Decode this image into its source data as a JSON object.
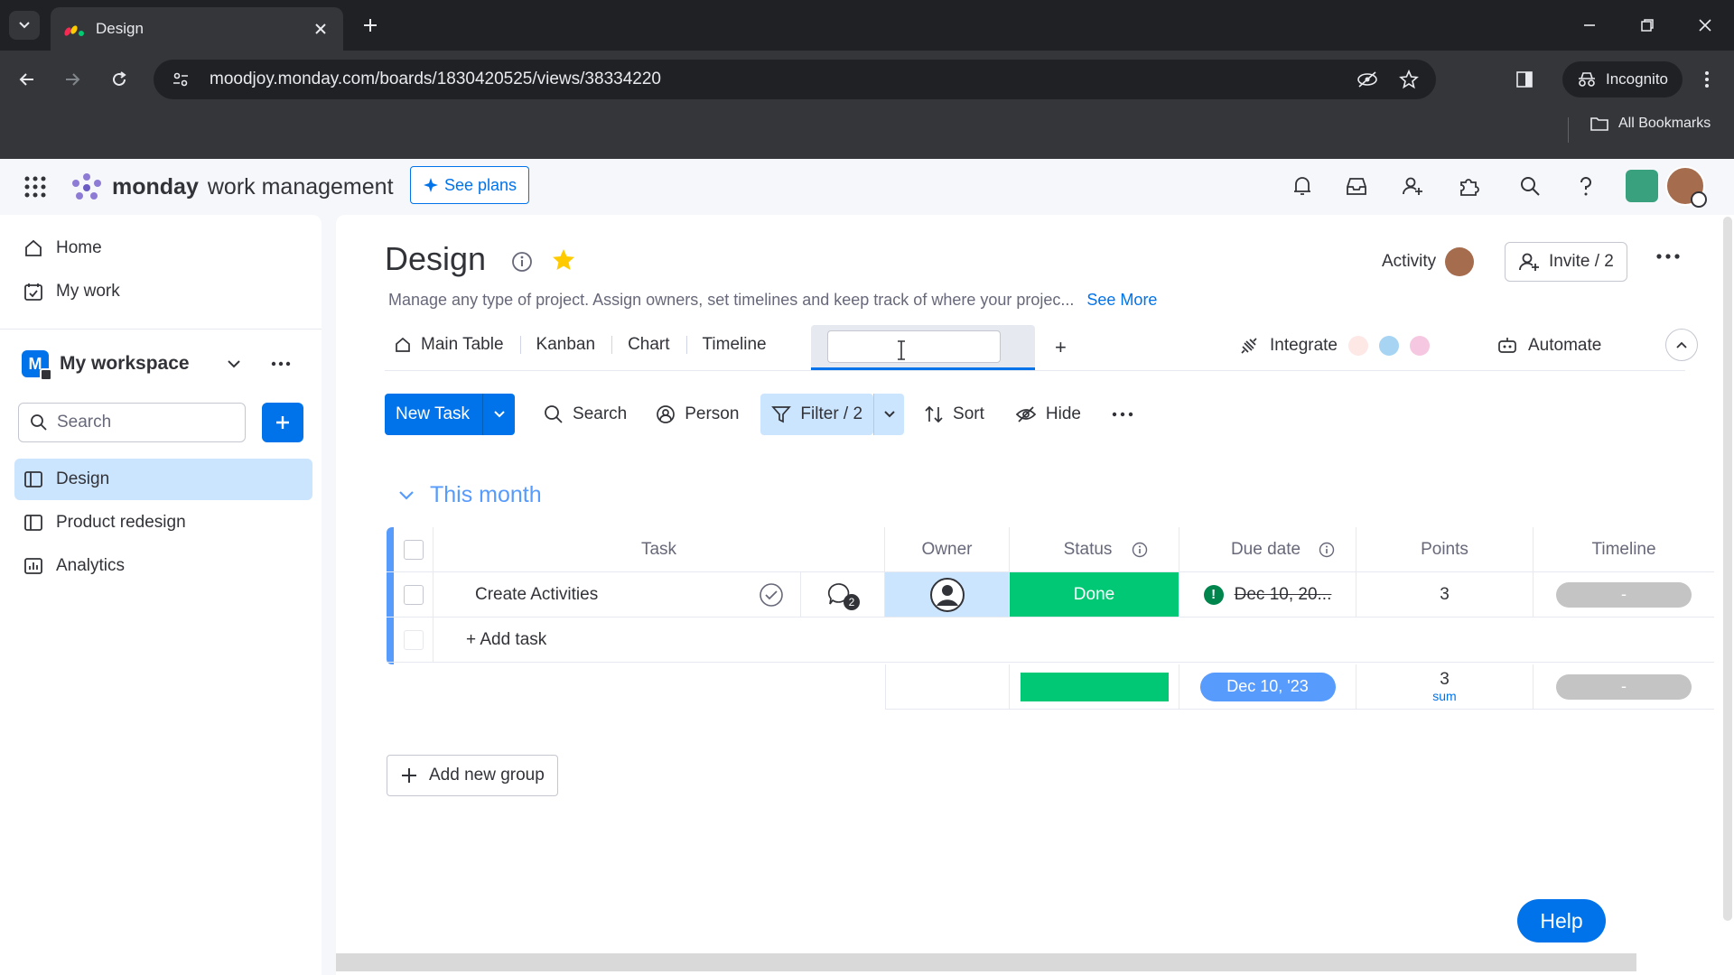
{
  "browser": {
    "tab_title": "Design",
    "url": "moodjoy.monday.com/boards/1830420525/views/38334220",
    "incognito_label": "Incognito",
    "bookmarks_label": "All Bookmarks"
  },
  "app": {
    "brand": "monday",
    "product": "work management",
    "see_plans": "See plans"
  },
  "sidebar": {
    "home": "Home",
    "my_work": "My work",
    "workspace": "My workspace",
    "workspace_initial": "M",
    "search_placeholder": "Search",
    "boards": [
      {
        "label": "Design",
        "active": true
      },
      {
        "label": "Product redesign",
        "active": false
      },
      {
        "label": "Analytics",
        "active": false
      }
    ]
  },
  "board": {
    "title": "Design",
    "description": "Manage any type of project. Assign owners, set timelines and keep track of where your projec...",
    "see_more": "See More",
    "activity": "Activity",
    "invite": "Invite / 2",
    "views": [
      "Main Table",
      "Kanban",
      "Chart",
      "Timeline"
    ],
    "new_view_value": "",
    "add_view": "+",
    "integrate": "Integrate",
    "automate": "Automate"
  },
  "actions": {
    "new_task": "New Task",
    "search": "Search",
    "person": "Person",
    "filter": "Filter / 2",
    "sort": "Sort",
    "hide": "Hide"
  },
  "group": {
    "title": "This month",
    "columns": [
      "Task",
      "Owner",
      "Status",
      "Due date",
      "Points",
      "Timeline"
    ],
    "rows": [
      {
        "task": "Create Activities",
        "updates_count": "2",
        "status": "Done",
        "due_date": "Dec 10, 20...",
        "points": "3",
        "timeline": "-"
      }
    ],
    "add_task": "+ Add task",
    "summary": {
      "due_date": "Dec 10, '23",
      "points": "3",
      "points_label": "sum",
      "timeline": "-"
    }
  },
  "add_group": "Add new group",
  "help": "Help",
  "colors": {
    "primary": "#0073ea",
    "done_green": "#00c875",
    "group_blue": "#579bfc",
    "active_blue": "#cce5ff"
  }
}
